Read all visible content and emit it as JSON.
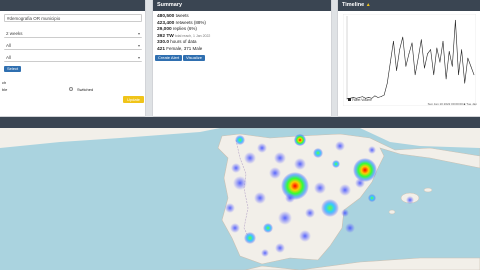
{
  "filters": {
    "search_value": "#demografia OR municipio",
    "period": "2 weeks",
    "select_a": "All",
    "select_b": "All",
    "select_button": "Select",
    "view_label": "ch",
    "radio_a": "ble",
    "radio_b": "Switched",
    "update_button": "Update"
  },
  "summary": {
    "title": "Summary",
    "lines": [
      {
        "value": "480,500",
        "label": "tweets",
        "note": ""
      },
      {
        "value": "423,400",
        "label": "retweets (88%)",
        "note": ""
      },
      {
        "value": "29,000",
        "label": "replies (6%)",
        "note": ""
      },
      {
        "value": "392 TW",
        "label": "",
        "note": "total reach, 1 Jan 2022"
      },
      {
        "value": "330.0",
        "label": "hours of data",
        "note": ""
      },
      {
        "value": "421",
        "label": "Female, 371 Male",
        "note": ""
      }
    ],
    "create_alert": "Create Alert",
    "visualize": "Visualize"
  },
  "timeline": {
    "title": "Timeline",
    "title_icon": "warning-icon",
    "legend": "Tweet Volume",
    "footer": "Sun Jan 10 2022 00:00:00 ■ Tue Jan"
  },
  "chart_data": {
    "type": "line",
    "title": "",
    "series": [
      {
        "values": [
          2,
          2,
          3,
          2,
          3,
          4,
          2,
          3,
          2,
          5,
          3,
          4,
          6,
          20,
          45,
          70,
          35,
          60,
          75,
          40,
          55,
          68,
          30,
          50,
          72,
          38,
          55,
          60,
          30,
          62,
          45,
          70,
          25,
          58,
          40,
          95,
          30,
          60,
          20,
          50,
          40,
          30
        ]
      }
    ],
    "ylim": [
      0,
      100
    ],
    "grid": false,
    "legend_position": "bottom-left",
    "colors": {
      "line": "#222222",
      "fill": "#ffffff"
    }
  },
  "map": {
    "hotspots": "heatmap"
  },
  "colors": {
    "header": "#3a4552",
    "accent_blue": "#2f6fb0",
    "accent_yellow": "#f0c419"
  }
}
